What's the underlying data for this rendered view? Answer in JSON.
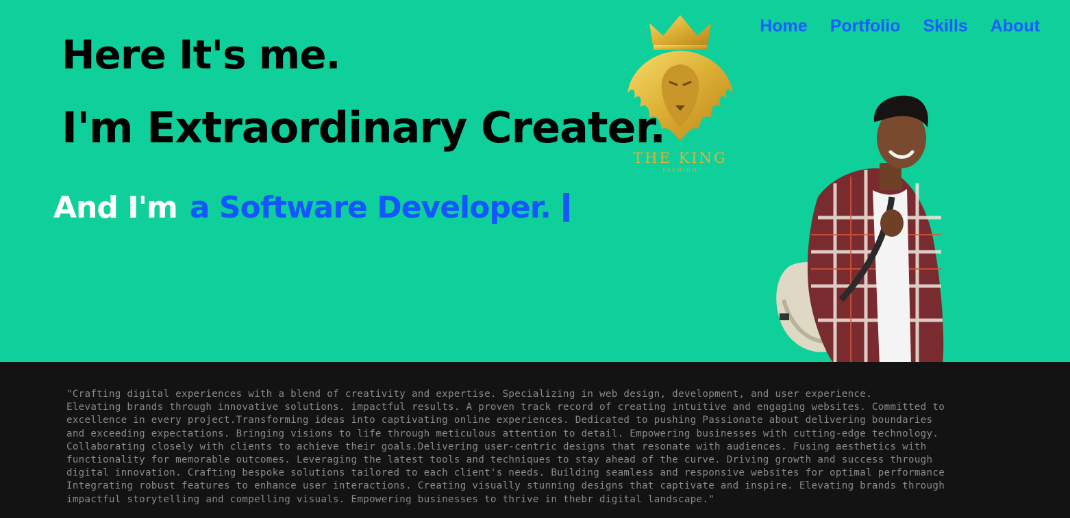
{
  "hero": {
    "line1": "Here It's me.",
    "line2": "I'm Extraordinary Creater.",
    "role_prefix": "And I'm",
    "role_text": "a Software Developer."
  },
  "nav": {
    "items": [
      "Home",
      "Portfolio",
      "Skills",
      "About"
    ]
  },
  "logo": {
    "title": "THE KING",
    "subtitle": "PREMIUM"
  },
  "bio": {
    "text": "\"Crafting digital experiences with a blend of creativity and expertise. Specializing in web design, development, and user experience.\nElevating brands through innovative solutions. impactful results. A proven track record of creating intuitive and engaging websites. Committed to\nexcellence in every project.Transforming ideas into captivating online experiences. Dedicated to pushing Passionate about delivering boundaries\nand exceeding expectations. Bringing visions to life through meticulous attention to detail. Empowering businesses with cutting-edge technology.\nCollaborating closely with clients to achieve their goals.Delivering user-centric designs that resonate with audiences. Fusing aesthetics with\nfunctionality for memorable outcomes. Leveraging the latest tools and techniques to stay ahead of the curve. Driving growth and success through\ndigital innovation. Crafting bespoke solutions tailored to each client's needs. Building seamless and responsive websites for optimal performance\nIntegrating robust features to enhance user interactions. Creating visually stunning designs that captivate and inspire. Elevating brands through\nimpactful storytelling and compelling visuals. Empowering businesses to thrive in thebr digital landscape.\""
  },
  "colors": {
    "hero_bg": "#0fcf9b",
    "nav_link": "#1b5cff",
    "role_text": "#1457ff",
    "bio_bg": "#141314",
    "bio_text": "#8a8a8a",
    "logo_gold": "#e0b23a"
  }
}
